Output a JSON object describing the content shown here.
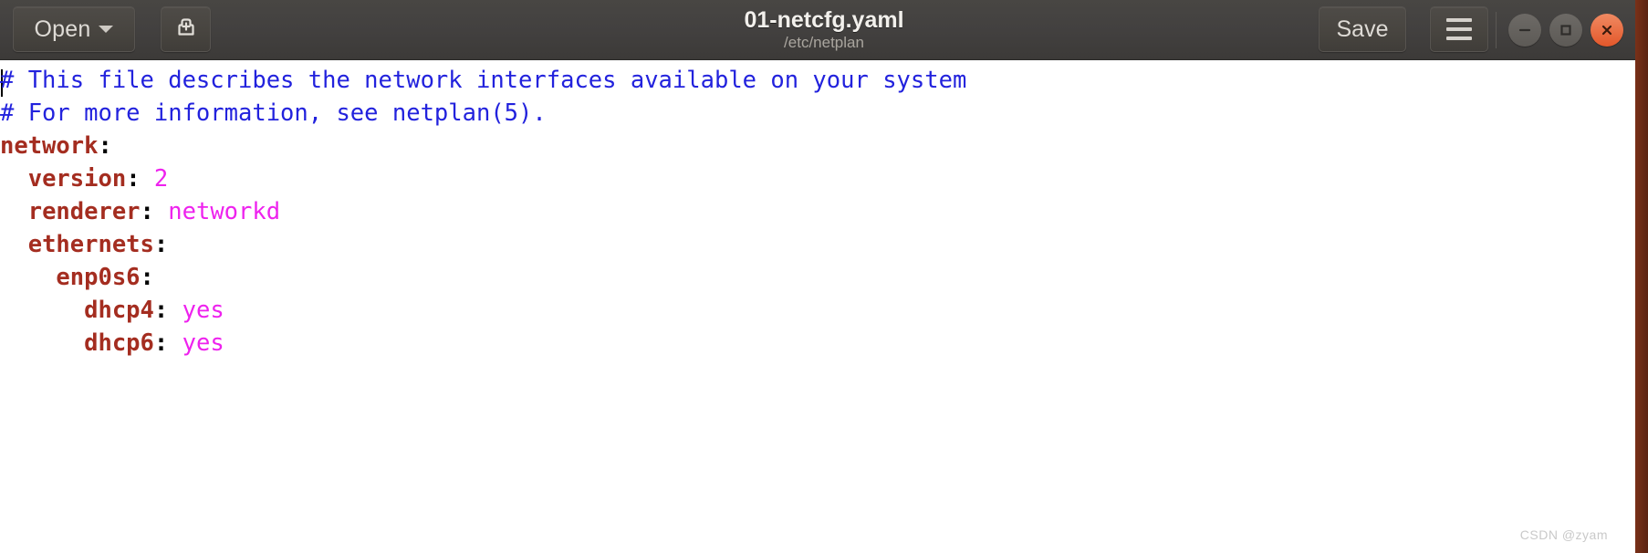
{
  "window": {
    "title": "01-netcfg.yaml",
    "subtitle": "/etc/netplan",
    "accent_color": "#e95420",
    "headerbar_color": "#434140",
    "edge_color": "#6b2a17"
  },
  "toolbar": {
    "open_label": "Open",
    "open_caret_icon": "chevron-down-icon",
    "save_as_icon": "save-as-icon",
    "save_label": "Save",
    "menu_icon": "hamburger-menu-icon"
  },
  "window_controls": {
    "minimize_icon": "minimize-icon",
    "maximize_icon": "maximize-icon",
    "close_icon": "close-icon"
  },
  "editor": {
    "lines": [
      {
        "indent": 0,
        "type": "comment",
        "text": "# This file describes the network interfaces available on your system"
      },
      {
        "indent": 0,
        "type": "comment",
        "text": "# For more information, see netplan(5)."
      },
      {
        "indent": 0,
        "type": "mapping",
        "key": "network",
        "punct": ":",
        "value": ""
      },
      {
        "indent": 2,
        "type": "mapping",
        "key": "version",
        "punct": ":",
        "value": "2"
      },
      {
        "indent": 2,
        "type": "mapping",
        "key": "renderer",
        "punct": ":",
        "value": "networkd"
      },
      {
        "indent": 2,
        "type": "mapping",
        "key": "ethernets",
        "punct": ":",
        "value": ""
      },
      {
        "indent": 4,
        "type": "mapping",
        "key": "enp0s6",
        "punct": ":",
        "value": ""
      },
      {
        "indent": 6,
        "type": "mapping",
        "key": "dhcp4",
        "punct": ":",
        "value": "yes"
      },
      {
        "indent": 6,
        "type": "mapping",
        "key": "dhcp6",
        "punct": ":",
        "value": "yes"
      }
    ],
    "syntax_colors": {
      "comment": "#2222dd",
      "key": "#a42d20",
      "value": "#ee22ee",
      "punctuation": "#000000",
      "background": "#ffffff"
    }
  },
  "watermark": {
    "text": "CSDN @zyam"
  }
}
